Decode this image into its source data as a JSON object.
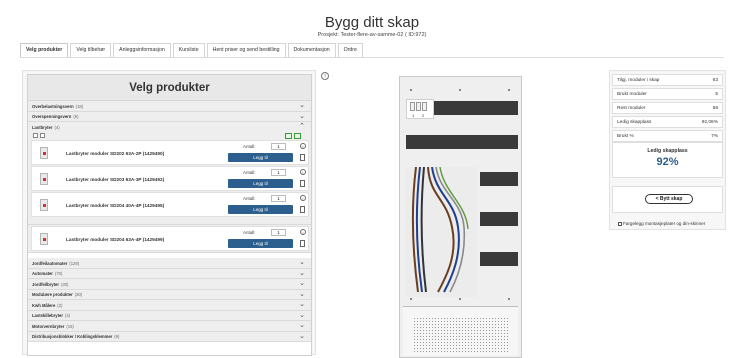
{
  "header": {
    "title": "Bygg ditt skap",
    "project": "Prosjekt: Tester-flere-av-samme-02 ( ID:972)"
  },
  "tabs": [
    "Velg produkter",
    "Velg tilbehør",
    "Anleggsinformasjon",
    "Kursliste",
    "Hent priser og send bestilling",
    "Dokumentasjon",
    "Ordre"
  ],
  "products_panel": {
    "title": "Velg produkter",
    "categories_before": [
      {
        "label": "Overbelastningsvern",
        "count": "(18)"
      },
      {
        "label": "Overspenningsvern",
        "count": "(6)"
      }
    ],
    "open_category": {
      "label": "Lastbryter",
      "count": "(4)"
    },
    "products": [
      {
        "name": "Lastbryter moduler SD202 63A-2P  (1429490)",
        "antall_label": "Antall:",
        "qty": "1",
        "add_label": "Legg til"
      },
      {
        "name": "Lastbryter moduler SD203 63A-3P  (1429492)",
        "antall_label": "Antall:",
        "qty": "1",
        "add_label": "Legg til"
      },
      {
        "name": "Lastbryter moduler SD204 40A-4P  (1429495)",
        "antall_label": "Antall:",
        "qty": "1",
        "add_label": "Legg til"
      },
      {
        "name": "Lastbryter moduler SD204 63A-4P  (1429499)",
        "antall_label": "Antall:",
        "qty": "1",
        "add_label": "Legg til"
      }
    ],
    "categories_after": [
      {
        "label": "Jordfeilautomater",
        "count": "(129)"
      },
      {
        "label": "Automater",
        "count": "(70)"
      },
      {
        "label": "Jordfeilbryter",
        "count": "(30)"
      },
      {
        "label": "Modulære produkter",
        "count": "(30)"
      },
      {
        "label": "Kwh Målere",
        "count": "(2)"
      },
      {
        "label": "Lastskillebryter",
        "count": "(4)"
      },
      {
        "label": "Motorvernbryter",
        "count": "(15)"
      },
      {
        "label": "Distribusjonsblokker / Koblingsklemmer",
        "count": "(9)"
      }
    ]
  },
  "cabinet": {
    "slot_numbers": [
      "1",
      "2"
    ]
  },
  "stats": {
    "rows": [
      {
        "label": "Tilgj. moduler i skap",
        "value": "63"
      },
      {
        "label": "Brukt moduler",
        "value": "5"
      },
      {
        "label": "Rest moduler",
        "value": "58"
      },
      {
        "label": "Ledig skapplass",
        "value": "92,06%"
      },
      {
        "label": "Brukt %",
        "value": "7%"
      }
    ],
    "ledig_label": "Ledig skapplass",
    "ledig_value": "92%",
    "bytt_skap": "< Bytt skap",
    "fargelegg": "Fargelegg montasjeplater og din-skinner"
  },
  "colors": {
    "primary_button": "#2d5f8e",
    "percent_text": "#2a5f8b",
    "selected_green": "#3a9a3a"
  }
}
